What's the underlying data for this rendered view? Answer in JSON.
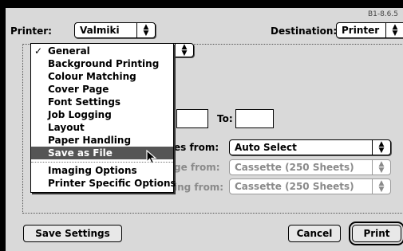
{
  "header": {
    "printer_label": "Printer:",
    "printer_value": "Valmiki",
    "destination_label": "Destination:",
    "destination_value": "Printer",
    "version": "B1-8.6.5"
  },
  "menu": {
    "items": [
      {
        "label": "General",
        "checked": true
      },
      {
        "label": "Background Printing"
      },
      {
        "label": "Colour Matching"
      },
      {
        "label": "Cover Page"
      },
      {
        "label": "Font Settings"
      },
      {
        "label": "Job Logging"
      },
      {
        "label": "Layout"
      },
      {
        "label": "Paper Handling"
      },
      {
        "label": "Save as File",
        "highlighted": true
      },
      {
        "label": "Imaging Options"
      },
      {
        "label": "Printer Specific Options"
      }
    ],
    "check_mark": "✓"
  },
  "general": {
    "to_label": "To:",
    "paper_source_first_label": "es from:",
    "paper_source_first_value": "Auto Select",
    "paper_source_remaining_label": "ge from:",
    "paper_source_remaining_value": "Cassette (250 Sheets)",
    "paper_source_third_label": "ing from:",
    "paper_source_third_value": "Cassette (250 Sheets)"
  },
  "footer": {
    "save_settings": "Save Settings",
    "cancel": "Cancel",
    "print": "Print"
  }
}
